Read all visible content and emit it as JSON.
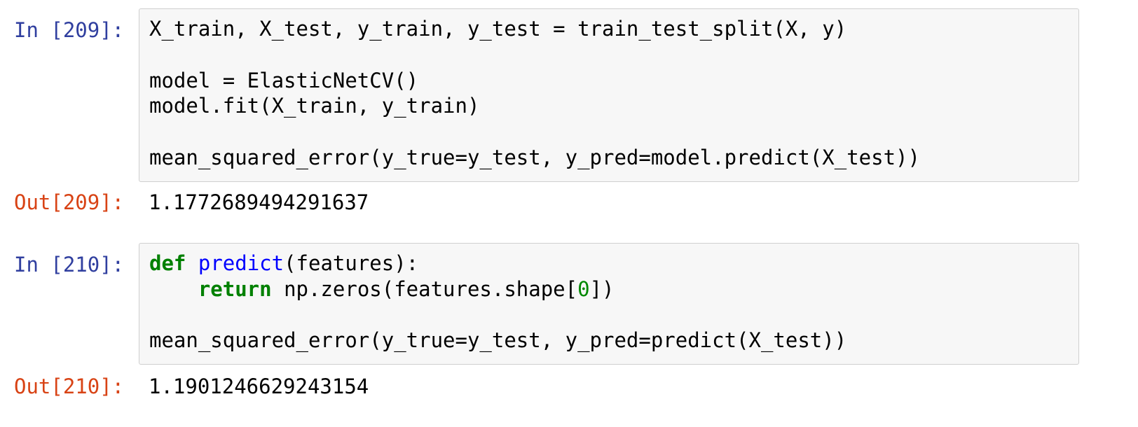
{
  "cells": [
    {
      "in_prompt": "In [209]:",
      "out_prompt": "Out[209]:",
      "code_lines": [
        "X_train, X_test, y_train, y_test = train_test_split(X, y)",
        "",
        "model = ElasticNetCV()",
        "model.fit(X_train, y_train)",
        "",
        "mean_squared_error(y_true=y_test, y_pred=model.predict(X_test))"
      ],
      "output": "1.1772689494291637"
    },
    {
      "in_prompt": "In [210]:",
      "out_prompt": "Out[210]:",
      "code": {
        "line1_kw": "def",
        "line1_fn": "predict",
        "line1_rest": "(features):",
        "line2_indent": "    ",
        "line2_kw": "return",
        "line2_a": " np.zeros(features.shape[",
        "line2_num": "0",
        "line2_b": "])",
        "line3": "",
        "line4": "mean_squared_error(y_true=y_test, y_pred=predict(X_test))"
      },
      "output": "1.1901246629243154"
    }
  ],
  "colors": {
    "in_prompt": "#303f9f",
    "out_prompt": "#d84315",
    "keyword": "#008000",
    "function_name": "#0000ff",
    "number": "#008800",
    "cell_background": "#f7f7f7",
    "cell_border": "#cfcfcf"
  }
}
